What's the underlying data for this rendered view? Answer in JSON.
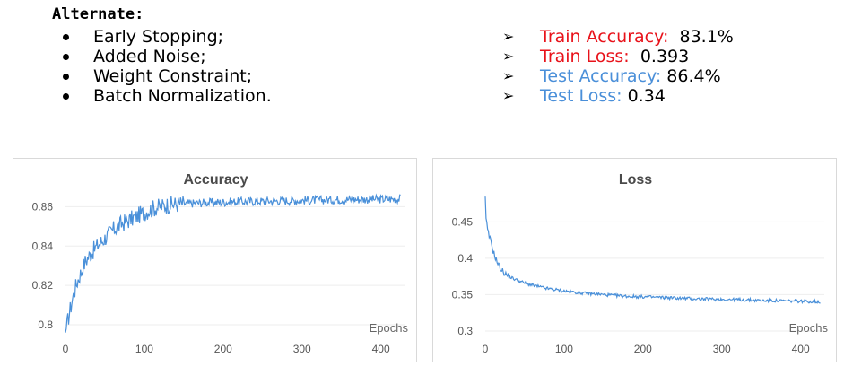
{
  "header": {
    "title": "Alternate:",
    "techniques": [
      "Early Stopping;",
      "Added Noise;",
      "Weight Constraint;",
      "Batch Normalization."
    ]
  },
  "metrics": [
    {
      "label": "Train Accuracy:",
      "value": "83.1%",
      "color": "#e8121a"
    },
    {
      "label": "Train Loss:",
      "value": "0.393",
      "color": "#e8121a"
    },
    {
      "label": "Test Accuracy:",
      "value": "86.4%",
      "color": "#4a8fd9"
    },
    {
      "label": "Test Loss:",
      "value": "0.34",
      "color": "#4a8fd9"
    }
  ],
  "chart_data": [
    {
      "type": "line",
      "title": "Accuracy",
      "xlabel": "Epochs",
      "ylabel": "",
      "xlim": [
        0,
        430
      ],
      "ylim": [
        0.795,
        0.867
      ],
      "xticks": [
        0,
        100,
        200,
        300,
        400
      ],
      "yticks": [
        0.8,
        0.82,
        0.84,
        0.86
      ],
      "ytick_labels": [
        "0.8",
        "0.82",
        "0.84",
        "0.86"
      ],
      "grid": true,
      "series": [
        {
          "color": "#4a90d9",
          "x": [
            0,
            2,
            5,
            10,
            15,
            20,
            25,
            30,
            40,
            50,
            60,
            70,
            80,
            90,
            100,
            110,
            120,
            130,
            150,
            175,
            200,
            225,
            250,
            275,
            300,
            325,
            350,
            375,
            400,
            425
          ],
          "y": [
            0.796,
            0.8,
            0.806,
            0.815,
            0.822,
            0.827,
            0.832,
            0.835,
            0.84,
            0.844,
            0.848,
            0.851,
            0.853,
            0.855,
            0.857,
            0.859,
            0.86,
            0.861,
            0.8615,
            0.862,
            0.8623,
            0.8626,
            0.8628,
            0.863,
            0.8632,
            0.8634,
            0.8636,
            0.8637,
            0.8638,
            0.864
          ]
        }
      ]
    },
    {
      "type": "line",
      "title": "Loss",
      "xlabel": "Epochs",
      "ylabel": "",
      "xlim": [
        0,
        430
      ],
      "ylim": [
        0.295,
        0.49
      ],
      "xticks": [
        0,
        100,
        200,
        300,
        400
      ],
      "yticks": [
        0.3,
        0.35,
        0.4,
        0.45
      ],
      "ytick_labels": [
        "0.3",
        "0.35",
        "0.4",
        "0.45"
      ],
      "grid": true,
      "series": [
        {
          "color": "#4a90d9",
          "x": [
            0,
            1,
            3,
            5,
            8,
            10,
            15,
            20,
            25,
            30,
            40,
            50,
            60,
            75,
            100,
            125,
            150,
            175,
            200,
            225,
            250,
            275,
            300,
            325,
            350,
            375,
            400,
            425
          ],
          "y": [
            0.485,
            0.455,
            0.438,
            0.43,
            0.42,
            0.41,
            0.395,
            0.385,
            0.379,
            0.375,
            0.37,
            0.366,
            0.363,
            0.359,
            0.355,
            0.352,
            0.35,
            0.348,
            0.347,
            0.346,
            0.345,
            0.344,
            0.3435,
            0.343,
            0.342,
            0.3415,
            0.341,
            0.34
          ]
        }
      ]
    }
  ]
}
